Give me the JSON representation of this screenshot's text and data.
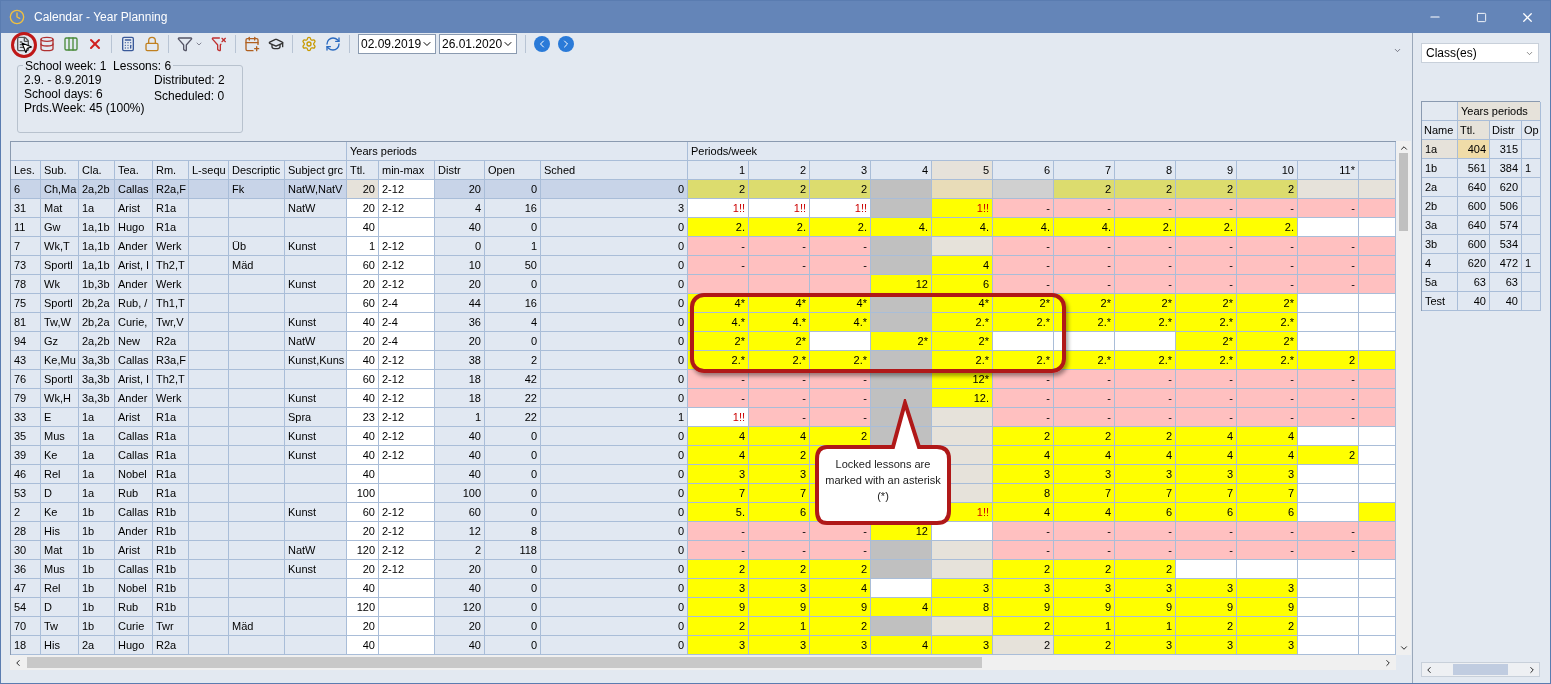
{
  "window": {
    "title": "Calendar - Year Planning"
  },
  "toolbar": {
    "date_from": "02.09.2019",
    "date_to": "26.01.2020"
  },
  "info": {
    "legend": "School week: 1  Lessons: 6",
    "left_lines": [
      "2.9. - 8.9.2019",
      "School days: 6",
      "Prds.Week: 45 (100%)"
    ],
    "right_lines": [
      "Distributed: 2",
      "Scheduled: 0"
    ]
  },
  "table": {
    "group_headers": [
      "Years periods",
      "Periods/week"
    ],
    "columns": [
      "Les.",
      "Sub.",
      "Cla.",
      "Tea.",
      "Rm.",
      "L-sequ",
      "Descriptic",
      "Subject grc",
      "Ttl.",
      "min-max",
      "Distr",
      "Open",
      "Sched"
    ],
    "period_columns": [
      "1",
      "2",
      "3",
      "4",
      "5",
      "6",
      "7",
      "8",
      "9",
      "10",
      "11*"
    ],
    "rows": [
      {
        "selected": true,
        "les": "6",
        "sub": "Ch,Ma",
        "cla": "2a,2b",
        "tea": "Callas",
        "rm": "R2a,F",
        "description": "Fk",
        "subject_group": "NatW,NatV",
        "ttl": "20",
        "min_max": "2-12",
        "distr": "20",
        "open": "0",
        "sched": "0",
        "periods": [
          {
            "color": "#dcdc6e",
            "text": "2"
          },
          {
            "color": "#dcdc6e",
            "text": "2"
          },
          {
            "color": "#dcdc6e",
            "text": "2"
          },
          {
            "color": "#c0c0c0"
          },
          {
            "color": "#e8dcb8"
          },
          {
            "color": "#d0d0d0"
          },
          {
            "color": "#dcdc6e",
            "text": "2"
          },
          {
            "color": "#dcdc6e",
            "text": "2"
          },
          {
            "color": "#dcdc6e",
            "text": "2"
          },
          {
            "color": "#dcdc6e",
            "text": "2"
          },
          {
            "color": "#e6e2da"
          },
          {
            "color": "#e6e2da"
          }
        ]
      },
      {
        "selected": false,
        "les": "31",
        "sub": "Mat",
        "cla": "1a",
        "tea": "Arist",
        "rm": "R1a",
        "subject_group": "NatW",
        "ttl": "20",
        "min_max": "2-12",
        "distr": "4",
        "open": "16",
        "sched": "3",
        "periods": [
          {
            "color": "#ffffff",
            "warning": {
              "text": "1!!",
              "color": "#cc0000"
            }
          },
          {
            "color": "#ffffff",
            "warning": {
              "text": "1!!",
              "color": "#cc0000"
            }
          },
          {
            "color": "#ffffff",
            "warning": {
              "text": "1!!",
              "color": "#cc0000"
            }
          },
          {
            "color": "#c0c0c0"
          },
          {
            "color": "#ffff00",
            "warning": {
              "text": "1!!",
              "color": "#cc0000"
            }
          },
          {
            "color": "#ffc0c0",
            "text": "-"
          },
          {
            "color": "#ffc0c0",
            "text": "-"
          },
          {
            "color": "#ffc0c0",
            "text": "-"
          },
          {
            "color": "#ffc0c0",
            "text": "-"
          },
          {
            "color": "#ffc0c0",
            "text": "-"
          },
          {
            "color": "#ffc0c0",
            "text": "-"
          },
          {
            "color": "#ffc0c0"
          }
        ]
      },
      {
        "selected": false,
        "les": "11",
        "sub": "Gw",
        "cla": "1a,1b",
        "tea": "Hugo",
        "rm": "R1a",
        "ttl": "40",
        "distr": "40",
        "open": "0",
        "sched": "0",
        "periods": [
          {
            "color": "#ffff00",
            "text": "2."
          },
          {
            "color": "#ffff00",
            "text": "2."
          },
          {
            "color": "#ffff00",
            "text": "2."
          },
          {
            "color": "#ffff00",
            "text": "4."
          },
          {
            "color": "#ffff00",
            "text": "4."
          },
          {
            "color": "#ffff00",
            "text": "4."
          },
          {
            "color": "#ffff00",
            "text": "4."
          },
          {
            "color": "#ffff00",
            "text": "2."
          },
          {
            "color": "#ffff00",
            "text": "2."
          },
          {
            "color": "#ffff00",
            "text": "2."
          },
          {
            "color": "#ffffff"
          },
          {
            "color": "#ffffff"
          }
        ]
      },
      {
        "selected": false,
        "les": "7",
        "sub": "Wk,T",
        "cla": "1a,1b",
        "tea": "Ander",
        "rm": "Werk",
        "description": "Üb",
        "subject_group": "Kunst",
        "ttl": "1",
        "min_max": "2-12",
        "distr": "0",
        "open": "1",
        "sched": "0",
        "periods": [
          {
            "color": "#ffc0c0",
            "text": "-"
          },
          {
            "color": "#ffc0c0",
            "text": "-"
          },
          {
            "color": "#ffc0c0",
            "text": "-"
          },
          {
            "color": "#c0c0c0"
          },
          {
            "color": "#e6e2da"
          },
          {
            "color": "#ffc0c0",
            "text": "-"
          },
          {
            "color": "#ffc0c0",
            "text": "-"
          },
          {
            "color": "#ffc0c0",
            "text": "-"
          },
          {
            "color": "#ffc0c0",
            "text": "-"
          },
          {
            "color": "#ffc0c0",
            "text": "-"
          },
          {
            "color": "#ffc0c0",
            "text": "-"
          },
          {
            "color": "#ffc0c0"
          }
        ]
      },
      {
        "selected": false,
        "les": "73",
        "sub": "Sportl",
        "cla": "1a,1b",
        "tea": "Arist, I",
        "rm": "Th2,T",
        "description": "Mäd",
        "ttl": "60",
        "min_max": "2-12",
        "distr": "10",
        "open": "50",
        "sched": "0",
        "periods": [
          {
            "color": "#ffc0c0",
            "text": "-"
          },
          {
            "color": "#ffc0c0",
            "text": "-"
          },
          {
            "color": "#ffc0c0",
            "text": "-"
          },
          {
            "color": "#c0c0c0"
          },
          {
            "color": "#ffff00",
            "text": "4"
          },
          {
            "color": "#ffc0c0",
            "text": "-"
          },
          {
            "color": "#ffc0c0",
            "text": "-"
          },
          {
            "color": "#ffc0c0",
            "text": "-"
          },
          {
            "color": "#ffc0c0",
            "text": "-"
          },
          {
            "color": "#ffc0c0",
            "text": "-"
          },
          {
            "color": "#ffc0c0",
            "text": "-"
          },
          {
            "color": "#ffc0c0"
          }
        ]
      },
      {
        "selected": false,
        "les": "78",
        "sub": "Wk",
        "cla": "1b,3b",
        "tea": "Ander",
        "rm": "Werk",
        "subject_group": "Kunst",
        "ttl": "20",
        "min_max": "2-12",
        "distr": "20",
        "open": "0",
        "sched": "0",
        "periods": [
          {
            "color": "#ffc0c0"
          },
          {
            "color": "#ffc0c0"
          },
          {
            "color": "#ffc0c0"
          },
          {
            "color": "#ffff00",
            "text": "12"
          },
          {
            "color": "#ffff00",
            "text": "6"
          },
          {
            "color": "#ffc0c0",
            "text": "-"
          },
          {
            "color": "#ffc0c0",
            "text": "-"
          },
          {
            "color": "#ffc0c0",
            "text": "-"
          },
          {
            "color": "#ffc0c0",
            "text": "-"
          },
          {
            "color": "#ffc0c0",
            "text": "-"
          },
          {
            "color": "#ffc0c0",
            "text": "-"
          },
          {
            "color": "#ffc0c0"
          }
        ]
      },
      {
        "selected": false,
        "les": "75",
        "sub": "Sportl",
        "cla": "2b,2a",
        "tea": "Rub, /",
        "rm": "Th1,T",
        "ttl": "60",
        "min_max": "2-4",
        "distr": "44",
        "open": "16",
        "sched": "0",
        "periods": [
          {
            "color": "#ffff00",
            "text": "4*"
          },
          {
            "color": "#ffff00",
            "text": "4*"
          },
          {
            "color": "#ffff00",
            "text": "4*"
          },
          {
            "color": "#c0c0c0"
          },
          {
            "color": "#ffff00",
            "text": "4*"
          },
          {
            "color": "#ffff00",
            "text": "2*"
          },
          {
            "color": "#ffff00",
            "text": "2*"
          },
          {
            "color": "#ffff00",
            "text": "2*"
          },
          {
            "color": "#ffff00",
            "text": "2*"
          },
          {
            "color": "#ffff00",
            "text": "2*"
          },
          {
            "color": "#ffffff"
          },
          {
            "color": "#ffffff"
          }
        ]
      },
      {
        "selected": false,
        "les": "81",
        "sub": "Tw,W",
        "cla": "2b,2a",
        "tea": "Curie,",
        "rm": "Twr,V",
        "subject_group": "Kunst",
        "ttl": "40",
        "min_max": "2-4",
        "distr": "36",
        "open": "4",
        "sched": "0",
        "periods": [
          {
            "color": "#ffff00",
            "text": "4.*"
          },
          {
            "color": "#ffff00",
            "text": "4.*"
          },
          {
            "color": "#ffff00",
            "text": "4.*"
          },
          {
            "color": "#c0c0c0"
          },
          {
            "color": "#ffff00",
            "text": "2.*"
          },
          {
            "color": "#ffff00",
            "text": "2.*"
          },
          {
            "color": "#ffff00",
            "text": "2.*"
          },
          {
            "color": "#ffff00",
            "text": "2.*"
          },
          {
            "color": "#ffff00",
            "text": "2.*"
          },
          {
            "color": "#ffff00",
            "text": "2.*"
          },
          {
            "color": "#ffffff"
          },
          {
            "color": "#ffffff"
          }
        ]
      },
      {
        "selected": false,
        "les": "94",
        "sub": "Gz",
        "cla": "2a,2b",
        "tea": "New",
        "rm": "R2a",
        "subject_group": "NatW",
        "ttl": "20",
        "min_max": "2-4",
        "distr": "20",
        "open": "0",
        "sched": "0",
        "periods": [
          {
            "color": "#ffff00",
            "text": "2*"
          },
          {
            "color": "#ffff00",
            "text": "2*"
          },
          {
            "color": "#ffffff"
          },
          {
            "color": "#ffff00",
            "text": "2*"
          },
          {
            "color": "#ffff00",
            "text": "2*"
          },
          {
            "color": "#ffffff"
          },
          {
            "color": "#ffffff"
          },
          {
            "color": "#ffffff"
          },
          {
            "color": "#ffff00",
            "text": "2*"
          },
          {
            "color": "#ffff00",
            "text": "2*"
          },
          {
            "color": "#ffffff"
          },
          {
            "color": "#ffffff"
          }
        ]
      },
      {
        "selected": false,
        "les": "43",
        "sub": "Ke,Mu",
        "cla": "3a,3b",
        "tea": "Callas",
        "rm": "R3a,F",
        "subject_group": "Kunst,Kuns",
        "ttl": "40",
        "min_max": "2-12",
        "distr": "38",
        "open": "2",
        "sched": "0",
        "periods": [
          {
            "color": "#ffff00",
            "text": "2.*"
          },
          {
            "color": "#ffff00",
            "text": "2.*"
          },
          {
            "color": "#ffff00",
            "text": "2.*"
          },
          {
            "color": "#c0c0c0"
          },
          {
            "color": "#ffff00",
            "text": "2.*"
          },
          {
            "color": "#ffff00",
            "text": "2.*"
          },
          {
            "color": "#ffff00",
            "text": "2.*"
          },
          {
            "color": "#ffff00",
            "text": "2.*"
          },
          {
            "color": "#ffff00",
            "text": "2.*"
          },
          {
            "color": "#ffff00",
            "text": "2.*"
          },
          {
            "color": "#ffff00",
            "text": "2"
          },
          {
            "color": "#ffff00"
          }
        ]
      },
      {
        "selected": false,
        "les": "76",
        "sub": "Sportl",
        "cla": "3a,3b",
        "tea": "Arist, I",
        "rm": "Th2,T",
        "ttl": "60",
        "min_max": "2-12",
        "distr": "18",
        "open": "42",
        "sched": "0",
        "periods": [
          {
            "color": "#ffc0c0",
            "text": "-"
          },
          {
            "color": "#ffc0c0",
            "text": "-"
          },
          {
            "color": "#ffc0c0",
            "text": "-"
          },
          {
            "color": "#c0c0c0"
          },
          {
            "color": "#ffff00",
            "text": "12*"
          },
          {
            "color": "#ffc0c0",
            "text": "-"
          },
          {
            "color": "#ffc0c0",
            "text": "-"
          },
          {
            "color": "#ffc0c0",
            "text": "-"
          },
          {
            "color": "#ffc0c0",
            "text": "-"
          },
          {
            "color": "#ffc0c0",
            "text": "-"
          },
          {
            "color": "#ffc0c0",
            "text": "-"
          },
          {
            "color": "#ffc0c0"
          }
        ]
      },
      {
        "selected": false,
        "les": "79",
        "sub": "Wk,H",
        "cla": "3a,3b",
        "tea": "Ander",
        "rm": "Werk",
        "subject_group": "Kunst",
        "ttl": "40",
        "min_max": "2-12",
        "distr": "18",
        "open": "22",
        "sched": "0",
        "periods": [
          {
            "color": "#ffc0c0",
            "text": "-"
          },
          {
            "color": "#ffc0c0",
            "text": "-"
          },
          {
            "color": "#ffc0c0",
            "text": "-"
          },
          {
            "color": "#c0c0c0"
          },
          {
            "color": "#ffff00",
            "text": "12."
          },
          {
            "color": "#ffc0c0",
            "text": "-"
          },
          {
            "color": "#ffc0c0",
            "text": "-"
          },
          {
            "color": "#ffc0c0",
            "text": "-"
          },
          {
            "color": "#ffc0c0",
            "text": "-"
          },
          {
            "color": "#ffc0c0",
            "text": "-"
          },
          {
            "color": "#ffc0c0",
            "text": "-"
          },
          {
            "color": "#ffc0c0"
          }
        ]
      },
      {
        "selected": false,
        "les": "33",
        "sub": "E",
        "cla": "1a",
        "tea": "Arist",
        "rm": "R1a",
        "subject_group": "Spra",
        "ttl": "23",
        "min_max": "2-12",
        "distr": "1",
        "open": "22",
        "sched": "1",
        "periods": [
          {
            "color": "#ffffff",
            "warning": {
              "text": "1!!",
              "color": "#cc0000"
            }
          },
          {
            "color": "#ffc0c0",
            "text": "-"
          },
          {
            "color": "#ffc0c0",
            "text": "-"
          },
          {
            "color": "#c0c0c0"
          },
          {
            "color": "#e6e2da"
          },
          {
            "color": "#ffc0c0",
            "text": "-"
          },
          {
            "color": "#ffc0c0",
            "text": "-"
          },
          {
            "color": "#ffc0c0",
            "text": "-"
          },
          {
            "color": "#ffc0c0",
            "text": "-"
          },
          {
            "color": "#ffc0c0",
            "text": "-"
          },
          {
            "color": "#ffc0c0",
            "text": "-"
          },
          {
            "color": "#ffc0c0"
          }
        ]
      },
      {
        "selected": false,
        "les": "35",
        "sub": "Mus",
        "cla": "1a",
        "tea": "Callas",
        "rm": "R1a",
        "subject_group": "Kunst",
        "ttl": "40",
        "min_max": "2-12",
        "distr": "40",
        "open": "0",
        "sched": "0",
        "periods": [
          {
            "color": "#ffff00",
            "text": "4"
          },
          {
            "color": "#ffff00",
            "text": "4"
          },
          {
            "color": "#ffff00",
            "text": "2"
          },
          {
            "color": "#c0c0c0"
          },
          {
            "color": "#e6e2da"
          },
          {
            "color": "#ffff00",
            "text": "2"
          },
          {
            "color": "#ffff00",
            "text": "2"
          },
          {
            "color": "#ffff00",
            "text": "2"
          },
          {
            "color": "#ffff00",
            "text": "4"
          },
          {
            "color": "#ffff00",
            "text": "4"
          },
          {
            "color": "#ffffff"
          },
          {
            "color": "#ffffff"
          }
        ]
      },
      {
        "selected": false,
        "les": "39",
        "sub": "Ke",
        "cla": "1a",
        "tea": "Callas",
        "rm": "R1a",
        "subject_group": "Kunst",
        "ttl": "40",
        "min_max": "2-12",
        "distr": "40",
        "open": "0",
        "sched": "0",
        "periods": [
          {
            "color": "#ffff00",
            "text": "4"
          },
          {
            "color": "#ffff00",
            "text": "2"
          },
          {
            "color": "#ffff00"
          }
        ],
        "periods_right": [
          {
            "color": "#e6e2da"
          },
          {
            "color": "#ffff00",
            "text": "4"
          },
          {
            "color": "#ffff00",
            "text": "4"
          },
          {
            "color": "#ffff00",
            "text": "4"
          },
          {
            "color": "#ffff00",
            "text": "4"
          },
          {
            "color": "#ffff00",
            "text": "4"
          },
          {
            "color": "#ffff00",
            "text": "2"
          },
          {
            "color": "#ffffff"
          }
        ]
      },
      {
        "selected": false,
        "les": "46",
        "sub": "Rel",
        "cla": "1a",
        "tea": "Nobel",
        "rm": "R1a",
        "ttl": "40",
        "distr": "40",
        "open": "0",
        "sched": "0",
        "periods": [
          {
            "color": "#ffff00",
            "text": "3"
          },
          {
            "color": "#ffff00",
            "text": "3"
          },
          {
            "color": "#ffff00"
          }
        ],
        "periods_right": [
          {
            "color": "#e6e2da"
          },
          {
            "color": "#ffff00",
            "text": "3"
          },
          {
            "color": "#ffff00",
            "text": "3"
          },
          {
            "color": "#ffff00",
            "text": "3"
          },
          {
            "color": "#ffff00",
            "text": "3"
          },
          {
            "color": "#ffff00",
            "text": "3"
          },
          {
            "color": "#ffffff"
          },
          {
            "color": "#ffffff"
          }
        ]
      },
      {
        "selected": false,
        "les": "53",
        "sub": "D",
        "cla": "1a",
        "tea": "Rub",
        "rm": "R1a",
        "ttl": "100",
        "distr": "100",
        "open": "0",
        "sched": "0",
        "periods": [
          {
            "color": "#ffff00",
            "text": "7"
          },
          {
            "color": "#ffff00",
            "text": "7"
          },
          {
            "color": "#ffff00"
          }
        ],
        "periods_right": [
          {
            "color": "#e6e2da"
          },
          {
            "color": "#ffff00",
            "text": "8"
          },
          {
            "color": "#ffff00",
            "text": "7"
          },
          {
            "color": "#ffff00",
            "text": "7"
          },
          {
            "color": "#ffff00",
            "text": "7"
          },
          {
            "color": "#ffff00",
            "text": "7"
          },
          {
            "color": "#ffffff"
          },
          {
            "color": "#ffffff"
          }
        ]
      },
      {
        "selected": false,
        "les": "2",
        "sub": "Ke",
        "cla": "1b",
        "tea": "Callas",
        "rm": "R1b",
        "subject_group": "Kunst",
        "ttl": "60",
        "min_max": "2-12",
        "distr": "60",
        "open": "0",
        "sched": "0",
        "periods": [
          {
            "color": "#ffff00",
            "text": "5."
          },
          {
            "color": "#ffff00",
            "text": "6"
          },
          {
            "color": "#ffff00"
          }
        ],
        "periods_right": [
          {
            "color": "#ffff00",
            "warning": {
              "text": "1!!",
              "color": "#cc0000"
            }
          },
          {
            "color": "#ffff00",
            "text": "4"
          },
          {
            "color": "#ffff00",
            "text": "4"
          },
          {
            "color": "#ffff00",
            "text": "6"
          },
          {
            "color": "#ffff00",
            "text": "6"
          },
          {
            "color": "#ffff00",
            "text": "6"
          },
          {
            "color": "#ffffff"
          },
          {
            "color": "#ffff00"
          }
        ]
      },
      {
        "selected": false,
        "les": "28",
        "sub": "His",
        "cla": "1b",
        "tea": "Ander",
        "rm": "R1b",
        "ttl": "20",
        "min_max": "2-12",
        "distr": "12",
        "open": "8",
        "sched": "0",
        "periods": [
          {
            "color": "#ffc0c0",
            "text": "-"
          },
          {
            "color": "#ffc0c0",
            "text": "-"
          },
          {
            "color": "#ffc0c0",
            "text": "-"
          },
          {
            "color": "#ffff00",
            "text": "12"
          },
          {
            "color": "#ffffff"
          },
          {
            "color": "#ffc0c0",
            "text": "-"
          },
          {
            "color": "#ffc0c0",
            "text": "-"
          },
          {
            "color": "#ffc0c0",
            "text": "-"
          },
          {
            "color": "#ffc0c0",
            "text": "-"
          },
          {
            "color": "#ffc0c0",
            "text": "-"
          },
          {
            "color": "#ffc0c0",
            "text": "-"
          },
          {
            "color": "#ffc0c0"
          }
        ]
      },
      {
        "selected": false,
        "les": "30",
        "sub": "Mat",
        "cla": "1b",
        "tea": "Arist",
        "rm": "R1b",
        "subject_group": "NatW",
        "ttl": "120",
        "min_max": "2-12",
        "distr": "2",
        "open": "118",
        "sched": "0",
        "periods": [
          {
            "color": "#ffc0c0",
            "text": "-"
          },
          {
            "color": "#ffc0c0",
            "text": "-"
          },
          {
            "color": "#ffc0c0",
            "text": "-"
          },
          {
            "color": "#c0c0c0"
          },
          {
            "color": "#e6e2da"
          },
          {
            "color": "#ffc0c0",
            "text": "-"
          },
          {
            "color": "#ffc0c0",
            "text": "-"
          },
          {
            "color": "#ffc0c0",
            "text": "-"
          },
          {
            "color": "#ffc0c0",
            "text": "-"
          },
          {
            "color": "#ffc0c0",
            "text": "-"
          },
          {
            "color": "#ffc0c0",
            "text": "-"
          },
          {
            "color": "#ffc0c0"
          }
        ]
      },
      {
        "selected": false,
        "les": "36",
        "sub": "Mus",
        "cla": "1b",
        "tea": "Callas",
        "rm": "R1b",
        "subject_group": "Kunst",
        "ttl": "20",
        "min_max": "2-12",
        "distr": "20",
        "open": "0",
        "sched": "0",
        "periods": [
          {
            "color": "#ffff00",
            "text": "2"
          },
          {
            "color": "#ffff00",
            "text": "2"
          },
          {
            "color": "#ffff00",
            "text": "2"
          },
          {
            "color": "#c0c0c0"
          },
          {
            "color": "#e6e2da"
          },
          {
            "color": "#ffff00",
            "text": "2"
          },
          {
            "color": "#ffff00",
            "text": "2"
          },
          {
            "color": "#ffff00",
            "text": "2"
          },
          {
            "color": "#ffffff"
          },
          {
            "color": "#ffffff"
          },
          {
            "color": "#ffffff"
          },
          {
            "color": "#ffffff"
          }
        ]
      },
      {
        "selected": false,
        "les": "47",
        "sub": "Rel",
        "cla": "1b",
        "tea": "Nobel",
        "rm": "R1b",
        "ttl": "40",
        "distr": "40",
        "open": "0",
        "sched": "0",
        "periods": [
          {
            "color": "#ffff00",
            "text": "3"
          },
          {
            "color": "#ffff00",
            "text": "3"
          },
          {
            "color": "#ffff00",
            "text": "4"
          },
          {
            "color": "#ffffff"
          },
          {
            "color": "#ffff00",
            "text": "3"
          },
          {
            "color": "#ffff00",
            "text": "3"
          },
          {
            "color": "#ffff00",
            "text": "3"
          },
          {
            "color": "#ffff00",
            "text": "3"
          },
          {
            "color": "#ffff00",
            "text": "3"
          },
          {
            "color": "#ffff00",
            "text": "3"
          },
          {
            "color": "#ffffff"
          },
          {
            "color": "#ffffff"
          }
        ]
      },
      {
        "selected": false,
        "les": "54",
        "sub": "D",
        "cla": "1b",
        "tea": "Rub",
        "rm": "R1b",
        "ttl": "120",
        "distr": "120",
        "open": "0",
        "sched": "0",
        "periods": [
          {
            "color": "#ffff00",
            "text": "9"
          },
          {
            "color": "#ffff00",
            "text": "9"
          },
          {
            "color": "#ffff00",
            "text": "9"
          },
          {
            "color": "#ffff00",
            "text": "4"
          },
          {
            "color": "#ffff00",
            "text": "8"
          },
          {
            "color": "#ffff00",
            "text": "9"
          },
          {
            "color": "#ffff00",
            "text": "9"
          },
          {
            "color": "#ffff00",
            "text": "9"
          },
          {
            "color": "#ffff00",
            "text": "9"
          },
          {
            "color": "#ffff00",
            "text": "9"
          },
          {
            "color": "#ffffff"
          },
          {
            "color": "#ffffff"
          }
        ]
      },
      {
        "selected": false,
        "les": "70",
        "sub": "Tw",
        "cla": "1b",
        "tea": "Curie",
        "rm": "Twr",
        "description": "Mäd",
        "ttl": "20",
        "distr": "20",
        "open": "0",
        "sched": "0",
        "periods": [
          {
            "color": "#ffff00",
            "text": "2"
          },
          {
            "color": "#ffff00",
            "text": "1"
          },
          {
            "color": "#ffff00",
            "text": "2"
          },
          {
            "color": "#c0c0c0"
          },
          {
            "color": "#e6e2da"
          },
          {
            "color": "#ffff00",
            "text": "2"
          },
          {
            "color": "#ffff00",
            "text": "1"
          },
          {
            "color": "#ffff00",
            "text": "1"
          },
          {
            "color": "#ffff00",
            "text": "2"
          },
          {
            "color": "#ffff00",
            "text": "2"
          },
          {
            "color": "#ffffff"
          },
          {
            "color": "#ffffff"
          }
        ]
      },
      {
        "selected": false,
        "les": "18",
        "sub": "His",
        "cla": "2a",
        "tea": "Hugo",
        "rm": "R2a",
        "ttl": "40",
        "distr": "40",
        "open": "0",
        "sched": "0",
        "periods": [
          {
            "color": "#ffff00",
            "text": "3"
          },
          {
            "color": "#ffff00",
            "text": "3"
          },
          {
            "color": "#ffff00",
            "text": "3"
          },
          {
            "color": "#ffff00",
            "text": "4"
          },
          {
            "color": "#ffff00",
            "text": "3"
          },
          {
            "color": "#e6e2da",
            "text": "2"
          },
          {
            "color": "#ffff00",
            "text": "2"
          },
          {
            "color": "#ffff00",
            "text": "3"
          },
          {
            "color": "#ffff00",
            "text": "3"
          },
          {
            "color": "#ffff00",
            "text": "3"
          },
          {
            "color": "#ffffff"
          },
          {
            "color": "#ffffff"
          }
        ]
      }
    ]
  },
  "callout": {
    "text": "Locked lessons are marked with an asterisk (*)"
  },
  "side_panel": {
    "filter": "Class(es)",
    "group_header": "Years periods",
    "columns": [
      "Name",
      "Ttl.",
      "Distr",
      "Op"
    ],
    "rows": [
      {
        "selected": true,
        "name": "1a",
        "ttl": "404",
        "distr": "315"
      },
      {
        "selected": false,
        "name": "1b",
        "ttl": "561",
        "distr": "384",
        "op": "1"
      },
      {
        "selected": false,
        "name": "2a",
        "ttl": "640",
        "distr": "620"
      },
      {
        "selected": false,
        "name": "2b",
        "ttl": "600",
        "distr": "506"
      },
      {
        "selected": false,
        "name": "3a",
        "ttl": "640",
        "distr": "574"
      },
      {
        "selected": false,
        "name": "3b",
        "ttl": "600",
        "distr": "534"
      },
      {
        "selected": false,
        "name": "4",
        "ttl": "620",
        "distr": "472",
        "op": "1"
      },
      {
        "selected": false,
        "name": "5a",
        "ttl": "63",
        "distr": "63"
      },
      {
        "selected": false,
        "name": "Test",
        "ttl": "40",
        "distr": "40"
      }
    ]
  }
}
